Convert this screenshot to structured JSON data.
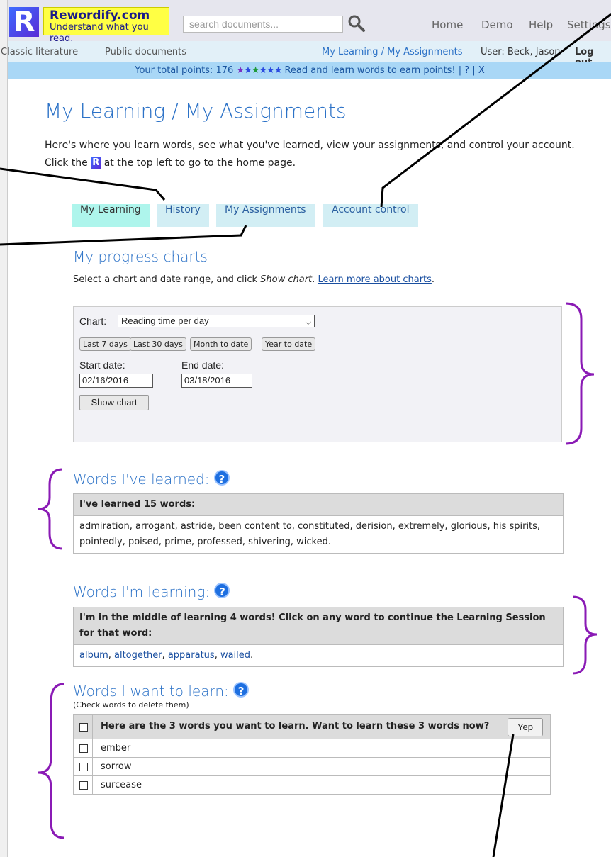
{
  "header": {
    "brand_name": "Rewordify.com",
    "brand_tagline": "Understand what you read.",
    "logo_letter": "R",
    "search_placeholder": "search documents...",
    "nav": [
      "Home",
      "Demo",
      "Help",
      "Settings"
    ]
  },
  "subnav": {
    "classic": "Classic literature",
    "public": "Public documents",
    "my_learning": "My Learning / My Assignments",
    "user": "User: Beck, Jason",
    "logout": "Log out"
  },
  "points_bar": {
    "prefix": "Your total points: 176",
    "stars": "★★★★★★",
    "suffix": "Read and learn words to earn points! |",
    "help_link": "?",
    "sep": "|",
    "close_link": "X"
  },
  "page": {
    "title": "My Learning / My Assignments",
    "intro_line1": "Here's where you learn words, see what you've learned, view your assignments, and control your account.",
    "intro_line2_a": "Click the",
    "intro_line2_b": "at the top left to go to the home page."
  },
  "tabs": [
    "My Learning",
    "History",
    "My Assignments",
    "Account control"
  ],
  "progress": {
    "heading": "My progress charts",
    "desc_a": "Select a chart and date range, and click",
    "desc_italic": "Show chart",
    "desc_b": ".",
    "desc_link": "Learn more about charts",
    "desc_end": ".",
    "chart_label": "Chart:",
    "chart_selected": "Reading time per day",
    "range_buttons": [
      "Last 7 days",
      "Last 30 days",
      "Month to date",
      "Year to date"
    ],
    "start_label": "Start date:",
    "end_label": "End date:",
    "start_value": "02/16/2016",
    "end_value": "03/18/2016",
    "show_button": "Show chart"
  },
  "learned": {
    "heading": "Words I've learned:",
    "header": "I've learned 15 words:",
    "words": "admiration, arrogant, astride, been content to, constituted, derision, extremely, glorious, his spirits, pointedly, poised, prime, professed, shivering, wicked."
  },
  "learning": {
    "heading": "Words I'm learning:",
    "header": "I'm in the middle of learning 4 words! Click on any word to continue the Learning Session for that word:",
    "words": [
      "album",
      "altogether",
      "apparatus",
      "wailed"
    ]
  },
  "want": {
    "heading": "Words I want to learn:",
    "note": "(Check words to delete them)",
    "header": "Here are the 3 words you want to learn. Want to learn these 3 words now?",
    "yep": "Yep",
    "words": [
      "ember",
      "sorrow",
      "surcease"
    ]
  },
  "help_glyph": "?"
}
